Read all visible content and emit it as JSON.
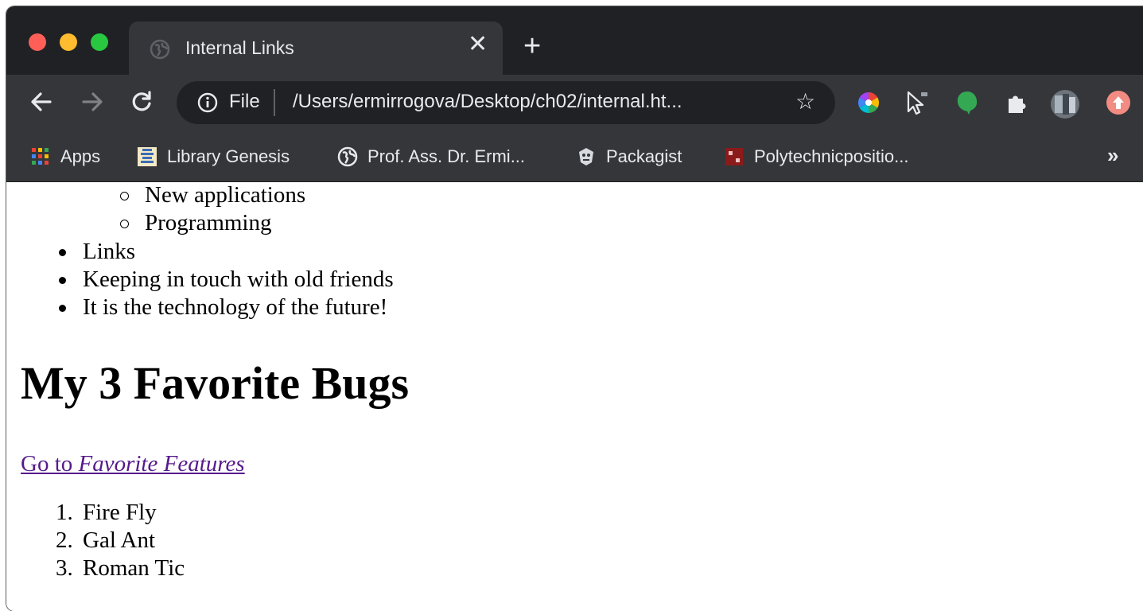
{
  "browser": {
    "tab": {
      "title": "Internal Links",
      "close": "✕",
      "new_tab": "+"
    },
    "omnibox": {
      "scheme_label": "File",
      "url": "/Users/ermirrogova/Desktop/ch02/internal.ht...",
      "star": "☆"
    },
    "bookmarks": [
      {
        "label": "Apps",
        "icon": "apps-grid-icon"
      },
      {
        "label": "Library Genesis",
        "icon": "library-icon"
      },
      {
        "label": "Prof. Ass. Dr. Ermi...",
        "icon": "globe-icon"
      },
      {
        "label": "Packagist",
        "icon": "packagist-icon"
      },
      {
        "label": "Polytechnicpositio...",
        "icon": "polytechnic-icon"
      }
    ],
    "bookmarks_more": "»",
    "colors": {
      "frame": "#202124",
      "toolbar": "#35363a",
      "text": "#e8eaed",
      "visited_link": "#551a8b"
    }
  },
  "page": {
    "sub_items": [
      "New applications",
      "Programming"
    ],
    "main_items": [
      "Links",
      "Keeping in touch with old friends",
      "It is the technology of the future!"
    ],
    "heading": "My 3 Favorite Bugs",
    "link": {
      "prefix": "Go to ",
      "emphasis": "Favorite Features"
    },
    "ordered_items": [
      {
        "num": "1.",
        "text": "Fire Fly"
      },
      {
        "num": "2.",
        "text": "Gal Ant"
      },
      {
        "num": "3.",
        "text": "Roman Tic"
      }
    ]
  }
}
